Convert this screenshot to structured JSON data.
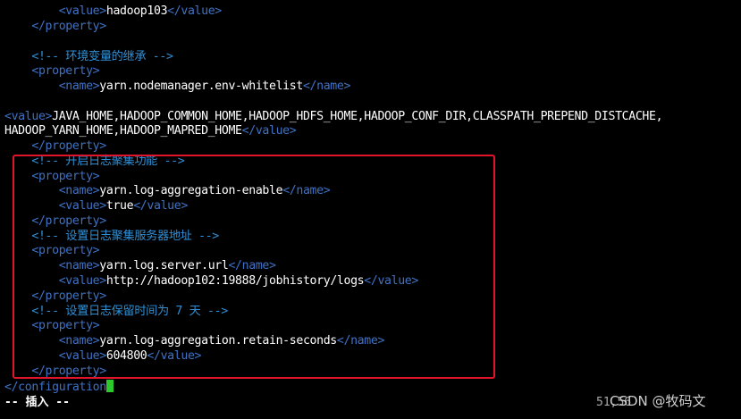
{
  "editor": {
    "lines": [
      [
        {
          "c": "txt",
          "t": "        "
        },
        {
          "c": "tag",
          "t": "<value>"
        },
        {
          "c": "txt",
          "t": "hadoop103"
        },
        {
          "c": "tag",
          "t": "</value>"
        }
      ],
      [
        {
          "c": "txt",
          "t": "    "
        },
        {
          "c": "tag",
          "t": "</property>"
        }
      ],
      [],
      [
        {
          "c": "txt",
          "t": "    "
        },
        {
          "c": "cmt",
          "t": "<!-- 环境变量的继承 -->"
        }
      ],
      [
        {
          "c": "txt",
          "t": "    "
        },
        {
          "c": "tag",
          "t": "<property>"
        }
      ],
      [
        {
          "c": "txt",
          "t": "        "
        },
        {
          "c": "tag",
          "t": "<name>"
        },
        {
          "c": "txt",
          "t": "yarn.nodemanager.env-whitelist"
        },
        {
          "c": "tag",
          "t": "</name>"
        }
      ],
      [],
      [
        {
          "c": "tag",
          "t": "<value>"
        },
        {
          "c": "txt",
          "t": "JAVA_HOME,HADOOP_COMMON_HOME,HADOOP_HDFS_HOME,HADOOP_CONF_DIR,CLASSPATH_PREPEND_DISTCACHE,"
        }
      ],
      [
        {
          "c": "txt",
          "t": "HADOOP_YARN_HOME,HADOOP_MAPRED_HOME"
        },
        {
          "c": "tag",
          "t": "</value>"
        }
      ],
      [
        {
          "c": "txt",
          "t": "    "
        },
        {
          "c": "tag",
          "t": "</property>"
        }
      ],
      [
        {
          "c": "txt",
          "t": "    "
        },
        {
          "c": "cmt",
          "t": "<!-- 开启日志聚集功能 -->"
        }
      ],
      [
        {
          "c": "txt",
          "t": "    "
        },
        {
          "c": "tag",
          "t": "<property>"
        }
      ],
      [
        {
          "c": "txt",
          "t": "        "
        },
        {
          "c": "tag",
          "t": "<name>"
        },
        {
          "c": "txt",
          "t": "yarn.log-aggregation-enable"
        },
        {
          "c": "tag",
          "t": "</name>"
        }
      ],
      [
        {
          "c": "txt",
          "t": "        "
        },
        {
          "c": "tag",
          "t": "<value>"
        },
        {
          "c": "txt",
          "t": "true"
        },
        {
          "c": "tag",
          "t": "</value>"
        }
      ],
      [
        {
          "c": "txt",
          "t": "    "
        },
        {
          "c": "tag",
          "t": "</property>"
        }
      ],
      [
        {
          "c": "txt",
          "t": "    "
        },
        {
          "c": "cmt",
          "t": "<!-- 设置日志聚集服务器地址 -->"
        }
      ],
      [
        {
          "c": "txt",
          "t": "    "
        },
        {
          "c": "tag",
          "t": "<property>"
        }
      ],
      [
        {
          "c": "txt",
          "t": "        "
        },
        {
          "c": "tag",
          "t": "<name>"
        },
        {
          "c": "txt",
          "t": "yarn.log.server.url"
        },
        {
          "c": "tag",
          "t": "</name>"
        }
      ],
      [
        {
          "c": "txt",
          "t": "        "
        },
        {
          "c": "tag",
          "t": "<value>"
        },
        {
          "c": "txt",
          "t": "http://hadoop102:19888/jobhistory/logs"
        },
        {
          "c": "tag",
          "t": "</value>"
        }
      ],
      [
        {
          "c": "txt",
          "t": "    "
        },
        {
          "c": "tag",
          "t": "</property>"
        }
      ],
      [
        {
          "c": "txt",
          "t": "    "
        },
        {
          "c": "cmt",
          "t": "<!-- 设置日志保留时间为 7 天 -->"
        }
      ],
      [
        {
          "c": "txt",
          "t": "    "
        },
        {
          "c": "tag",
          "t": "<property>"
        }
      ],
      [
        {
          "c": "txt",
          "t": "        "
        },
        {
          "c": "tag",
          "t": "<name>"
        },
        {
          "c": "txt",
          "t": "yarn.log-aggregation.retain-seconds"
        },
        {
          "c": "tag",
          "t": "</name>"
        }
      ],
      [
        {
          "c": "txt",
          "t": "        "
        },
        {
          "c": "tag",
          "t": "<value>"
        },
        {
          "c": "txt",
          "t": "604800"
        },
        {
          "c": "tag",
          "t": "</value>"
        }
      ],
      [
        {
          "c": "txt",
          "t": "    "
        },
        {
          "c": "tag",
          "t": "</property>"
        }
      ],
      [
        {
          "c": "tag",
          "t": "</configuration"
        },
        {
          "c": "cursor",
          "t": ""
        }
      ]
    ],
    "status_mode": "-- 插入 --",
    "cursor_position": "51,56",
    "watermark": "CSDN @牧码文"
  },
  "colors": {
    "background": "#000000",
    "tag": "#3f72c5",
    "text": "#ffffff",
    "comment": "#2f8fd6",
    "highlight_border": "#e0142a",
    "cursor": "#2cc82c"
  }
}
